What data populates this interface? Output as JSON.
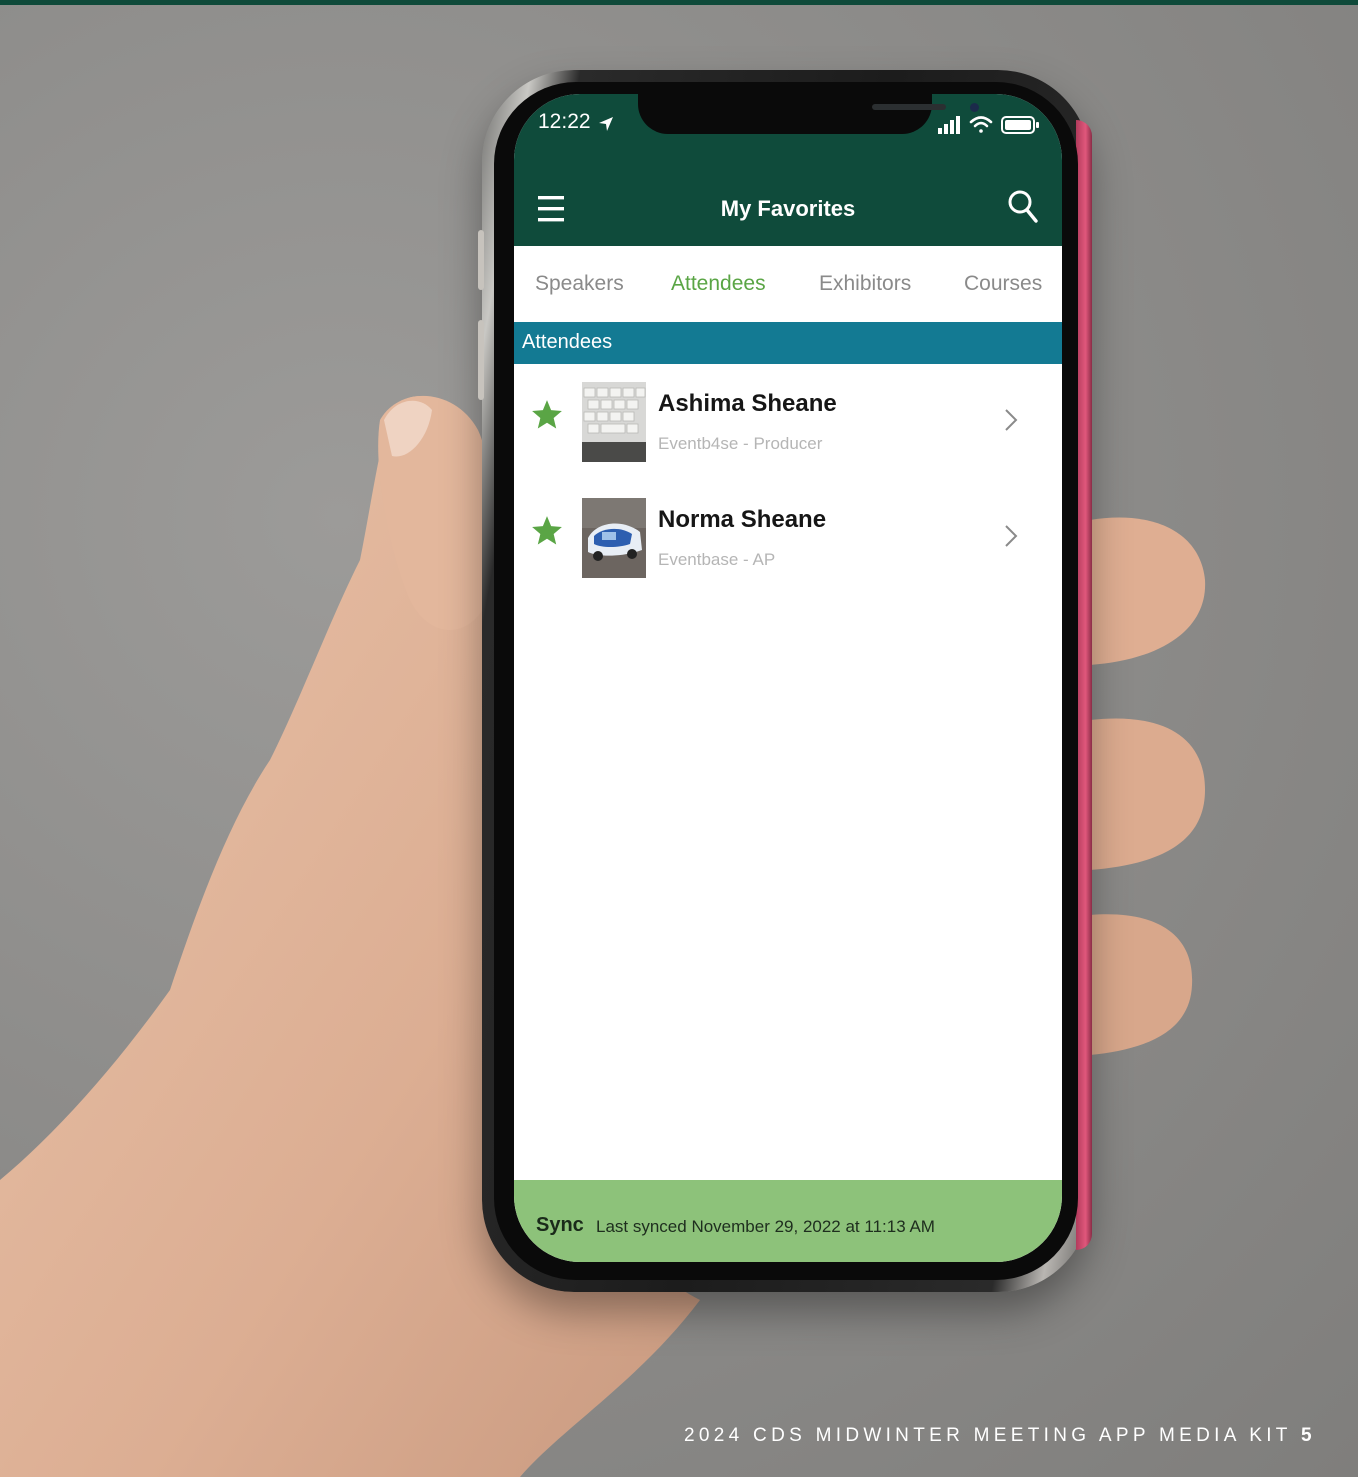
{
  "status_bar": {
    "time": "12:22"
  },
  "header": {
    "title": "My Favorites"
  },
  "tabs": [
    {
      "label": "Speakers",
      "active": false
    },
    {
      "label": "Attendees",
      "active": true
    },
    {
      "label": "Exhibitors",
      "active": false
    },
    {
      "label": "Courses",
      "active": false
    }
  ],
  "section": {
    "title": "Attendees"
  },
  "attendees": [
    {
      "name": "Ashima Sheane",
      "subtitle": "Eventb4se - Producer",
      "favorite": true
    },
    {
      "name": "Norma Sheane",
      "subtitle": "Eventbase - AP",
      "favorite": true
    }
  ],
  "sync": {
    "label": "Sync",
    "status": "Last synced November 29, 2022 at 11:13 AM"
  },
  "footer": {
    "text": "2024 CDS MIDWINTER MEETING APP MEDIA KIT",
    "page": "5"
  },
  "colors": {
    "header_green": "#0f4b3b",
    "active_tab": "#5aa545",
    "section_bar": "#137a93",
    "sync_bar": "#8dc27a",
    "star": "#5aa545"
  },
  "icons": {
    "menu": "hamburger-menu-icon",
    "search": "search-icon",
    "favorite": "star-icon",
    "row_action": "chevron-right-icon",
    "status": [
      "location-arrow-icon",
      "signal-icon",
      "wifi-icon",
      "battery-icon"
    ]
  }
}
